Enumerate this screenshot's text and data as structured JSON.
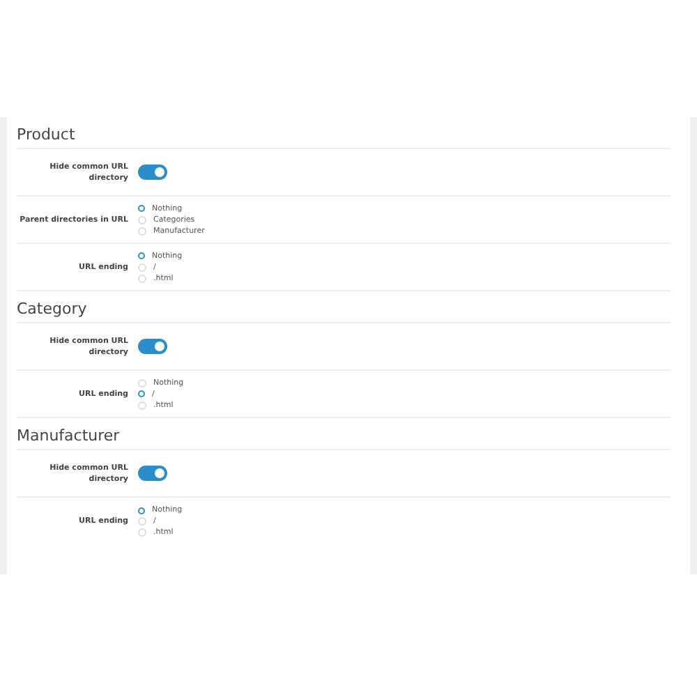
{
  "sections": [
    {
      "title": "Product",
      "rows": [
        {
          "kind": "toggle",
          "label": "Hide common URL directory",
          "on": true
        },
        {
          "kind": "radio",
          "label": "Parent directories in URL",
          "options": [
            {
              "label": "Nothing",
              "selected": true
            },
            {
              "label": "Categories",
              "selected": false
            },
            {
              "label": "Manufacturer",
              "selected": false
            }
          ]
        },
        {
          "kind": "radio",
          "label": "URL ending",
          "options": [
            {
              "label": "Nothing",
              "selected": true
            },
            {
              "label": "/",
              "selected": false
            },
            {
              "label": ".html",
              "selected": false
            }
          ]
        }
      ]
    },
    {
      "title": "Category",
      "rows": [
        {
          "kind": "toggle",
          "label": "Hide common URL directory",
          "on": true
        },
        {
          "kind": "radio",
          "label": "URL ending",
          "options": [
            {
              "label": "Nothing",
              "selected": false
            },
            {
              "label": "/",
              "selected": true
            },
            {
              "label": ".html",
              "selected": false
            }
          ]
        }
      ]
    },
    {
      "title": "Manufacturer",
      "rows": [
        {
          "kind": "toggle",
          "label": "Hide common URL directory",
          "on": true
        },
        {
          "kind": "radio",
          "label": "URL ending",
          "options": [
            {
              "label": "Nothing",
              "selected": true
            },
            {
              "label": "/",
              "selected": false
            },
            {
              "label": ".html",
              "selected": false
            }
          ]
        }
      ]
    }
  ]
}
